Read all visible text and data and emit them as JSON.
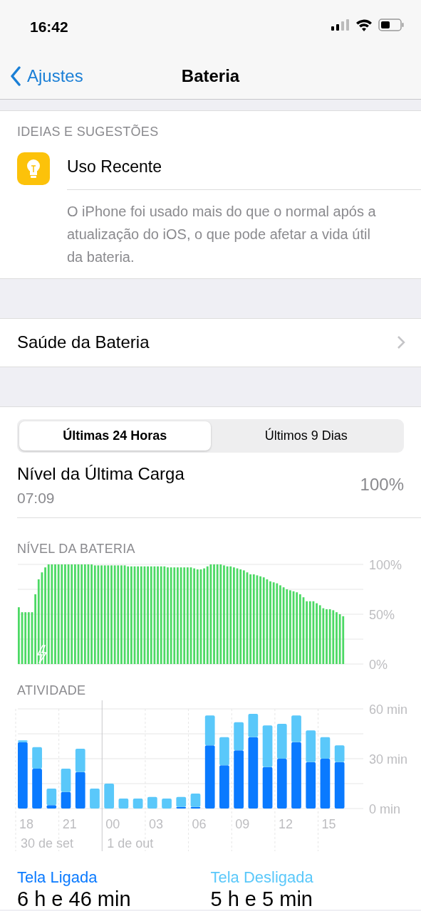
{
  "status_bar": {
    "time": "16:42"
  },
  "nav": {
    "back": "Ajustes",
    "title": "Bateria"
  },
  "suggestions": {
    "header": "IDEIAS E SUGESTÕES",
    "title": "Uso Recente",
    "description": "O iPhone foi usado mais do que o normal após a atualização do iOS, o que pode afetar a vida útil da bateria."
  },
  "health_row": {
    "label": "Saúde da Bateria"
  },
  "tabs": [
    {
      "label": "Últimas 24 Horas",
      "selected": true
    },
    {
      "label": "Últimos 9 Dias",
      "selected": false
    }
  ],
  "last_charge": {
    "label": "Nível da Última Carga",
    "time": "07:09",
    "value": "100%"
  },
  "battery_level": {
    "header": "NÍVEL DA BATERIA",
    "chart_data": {
      "type": "bar",
      "ylim": [
        0,
        100
      ],
      "yticks": [
        {
          "value": 0,
          "label": "0%"
        },
        {
          "value": 50,
          "label": "50%"
        },
        {
          "value": 100,
          "label": "100%"
        }
      ],
      "series": [
        {
          "color": "#4cd964",
          "values": [
            57,
            52,
            52,
            52,
            52,
            70,
            85,
            92,
            97,
            100,
            100,
            100,
            100,
            100,
            100,
            100,
            100,
            100,
            100,
            100,
            100,
            100,
            100,
            99,
            99,
            99,
            99,
            99,
            99,
            99,
            99,
            99,
            99,
            98,
            98,
            98,
            98,
            98,
            98,
            98,
            98,
            98,
            98,
            98,
            98,
            97,
            97,
            97,
            97,
            97,
            97,
            97,
            97,
            96,
            95,
            95,
            96,
            98,
            100,
            100,
            100,
            100,
            99,
            98,
            98,
            97,
            96,
            95,
            94,
            92,
            90,
            90,
            89,
            88,
            87,
            85,
            83,
            82,
            81,
            79,
            77,
            75,
            74,
            73,
            72,
            70,
            67,
            63,
            63,
            63,
            61,
            59,
            56,
            55,
            55,
            54,
            52,
            50,
            48
          ]
        }
      ]
    }
  },
  "activity": {
    "header": "ATIVIDADE",
    "chart_data": {
      "type": "bar",
      "stacked": true,
      "ylim": [
        0,
        60
      ],
      "yticks": [
        {
          "value": 0,
          "label": "0 min"
        },
        {
          "value": 30,
          "label": "30 min"
        },
        {
          "value": 60,
          "label": "60 min"
        }
      ],
      "series": [
        {
          "name": "Tela Ligada",
          "color": "#0a7aff",
          "values": [
            40,
            24,
            2,
            10,
            22,
            0,
            0,
            0,
            0,
            0,
            0,
            1,
            1,
            38,
            26,
            35,
            43,
            25,
            30,
            40,
            28,
            30,
            28
          ]
        },
        {
          "name": "Tela Desligada",
          "color": "#5ac8fa",
          "values": [
            1,
            13,
            10,
            14,
            14,
            12,
            15,
            6,
            6,
            7,
            6,
            6,
            8,
            18,
            17,
            17,
            14,
            25,
            21,
            16,
            19,
            13,
            10
          ]
        }
      ]
    },
    "hour_labels": [
      {
        "label": "18",
        "date": "30 de set"
      },
      {
        "label": "21"
      },
      {
        "label": "00",
        "date": "1 de out"
      },
      {
        "label": "03"
      },
      {
        "label": "06"
      },
      {
        "label": "09"
      },
      {
        "label": "12"
      },
      {
        "label": "15"
      }
    ]
  },
  "totals": [
    "6 h e 46 min",
    "5 h e 5 min"
  ]
}
